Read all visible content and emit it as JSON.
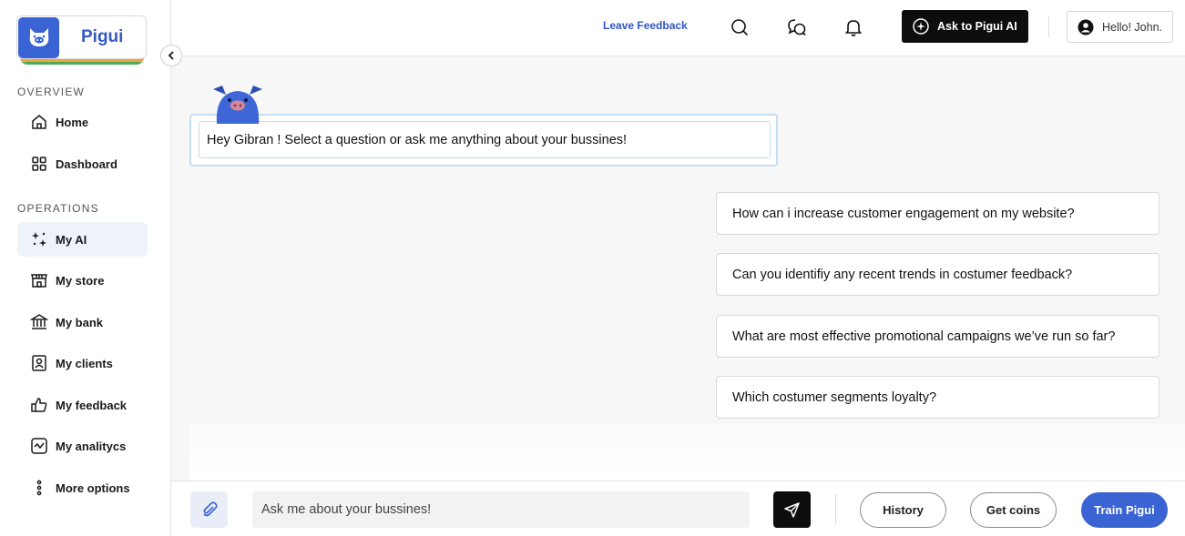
{
  "brand": {
    "name": "Pigui",
    "accent": "#3a63d4",
    "stripe_colors": [
      "#e8473f",
      "#f2a33a",
      "#4cab5a",
      "#3a63d4"
    ]
  },
  "sidebar": {
    "overview_label": "OVERVIEW",
    "operations_label": "OPERATIONS",
    "overview_items": [
      {
        "label": "Home",
        "icon": "home-icon"
      },
      {
        "label": "Dashboard",
        "icon": "grid-icon"
      }
    ],
    "operations_items": [
      {
        "label": "My AI",
        "icon": "sparkles-icon",
        "active": true
      },
      {
        "label": "My store",
        "icon": "store-icon"
      },
      {
        "label": "My bank",
        "icon": "bank-icon"
      },
      {
        "label": "My clients",
        "icon": "client-icon"
      },
      {
        "label": "My feedback",
        "icon": "thumbs-up-icon"
      },
      {
        "label": "My analitycs",
        "icon": "analytics-icon"
      },
      {
        "label": "More options",
        "icon": "more-vertical-icon"
      }
    ]
  },
  "topbar": {
    "feedback_link": "Leave Feedback",
    "ask_button": "Ask to Pigui AI",
    "user_greeting": "Hello! John."
  },
  "chat": {
    "bot_message": "Hey Gibran ! Select a question or ask me anything about your bussines!",
    "suggestions": [
      "How can i increase customer engagement on my website?",
      "Can you identifiy any recent trends in costumer feedback?",
      "What are most effective promotional campaigns we’ve run so far?",
      "Which costumer segments loyalty?"
    ]
  },
  "composer": {
    "placeholder": "Ask me about your bussines!",
    "history_button": "History",
    "coins_button": "Get coins",
    "train_button": "Train Pigui"
  }
}
